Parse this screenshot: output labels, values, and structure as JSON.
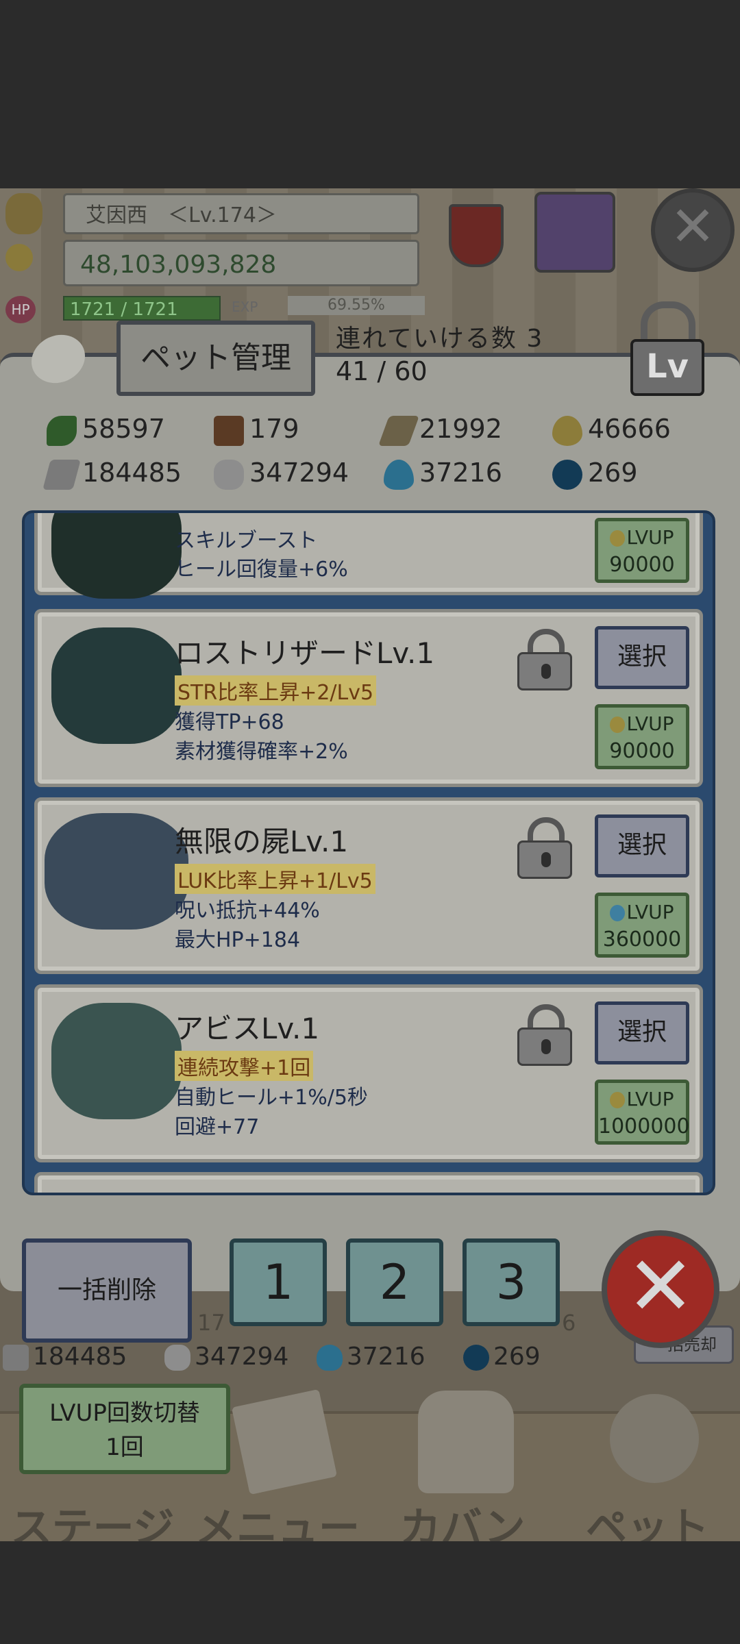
{
  "hud": {
    "player_name": "艾因西　＜Lv.174＞",
    "gold": "48,103,093,828",
    "hp": "1721 / 1721",
    "exp_label": "EXP",
    "exp_percent": "69.55%"
  },
  "panel": {
    "title": "ペット管理",
    "capacity_label": "連れていける数 3",
    "capacity_count": "41 / 60",
    "lv_lock_label": "Lv"
  },
  "resources": [
    {
      "icon": "leaf-icon",
      "value": "58597"
    },
    {
      "icon": "wood-log-icon",
      "value": "179"
    },
    {
      "icon": "plank-icon",
      "value": "21992"
    },
    {
      "icon": "gold-drop-icon",
      "value": "46666"
    },
    {
      "icon": "iron-ingot-icon",
      "value": "184485"
    },
    {
      "icon": "ore-icon",
      "value": "347294"
    },
    {
      "icon": "blue-flame-icon",
      "value": "37216"
    },
    {
      "icon": "dark-orb-icon",
      "value": "269"
    }
  ],
  "pets": [
    {
      "name": "",
      "stats": [
        "スキルブースト",
        "ヒール回復量+6%"
      ],
      "lvup_label": "LVUP",
      "lvup_cost": "90000",
      "cost_icon": "gold-drop-icon"
    },
    {
      "name": "ロストリザードLv.1",
      "highlight": "STR比率上昇+2/Lv5",
      "stats": [
        "獲得TP+68",
        "素材獲得確率+2%"
      ],
      "select_label": "選択",
      "lvup_label": "LVUP",
      "lvup_cost": "90000",
      "cost_icon": "gold-drop-icon"
    },
    {
      "name": "無限の屍Lv.1",
      "highlight": "LUK比率上昇+1/Lv5",
      "stats": [
        "呪い抵抗+44%",
        "最大HP+184"
      ],
      "select_label": "選択",
      "lvup_label": "LVUP",
      "lvup_cost": "360000",
      "cost_icon": "blue-flame-icon"
    },
    {
      "name": "アビスLv.1",
      "highlight": "連続攻撃+1回",
      "stats": [
        "自動ヒール+1%/5秒",
        "回避+77"
      ],
      "select_label": "選択",
      "lvup_label": "LVUP",
      "lvup_cost": "1000000",
      "cost_icon": "gold-drop-icon"
    }
  ],
  "bottom": {
    "delete_all": "一括削除",
    "slots": [
      "1",
      "2",
      "3"
    ],
    "bg_number_left": "17",
    "bg_number_right": "6",
    "sell_all": "一括売却",
    "resources": [
      {
        "icon": "iron-ingot-icon",
        "value": "184485"
      },
      {
        "icon": "ore-icon",
        "value": "347294"
      },
      {
        "icon": "blue-flame-icon",
        "value": "37216"
      },
      {
        "icon": "dark-orb-icon",
        "value": "269"
      }
    ],
    "lvup_toggle_line1": "LVUP回数切替",
    "lvup_toggle_line2": "1回"
  },
  "nav": {
    "stage": "ステージ",
    "menu": "メニュー",
    "bag": "カバン",
    "pet": "ペット"
  }
}
